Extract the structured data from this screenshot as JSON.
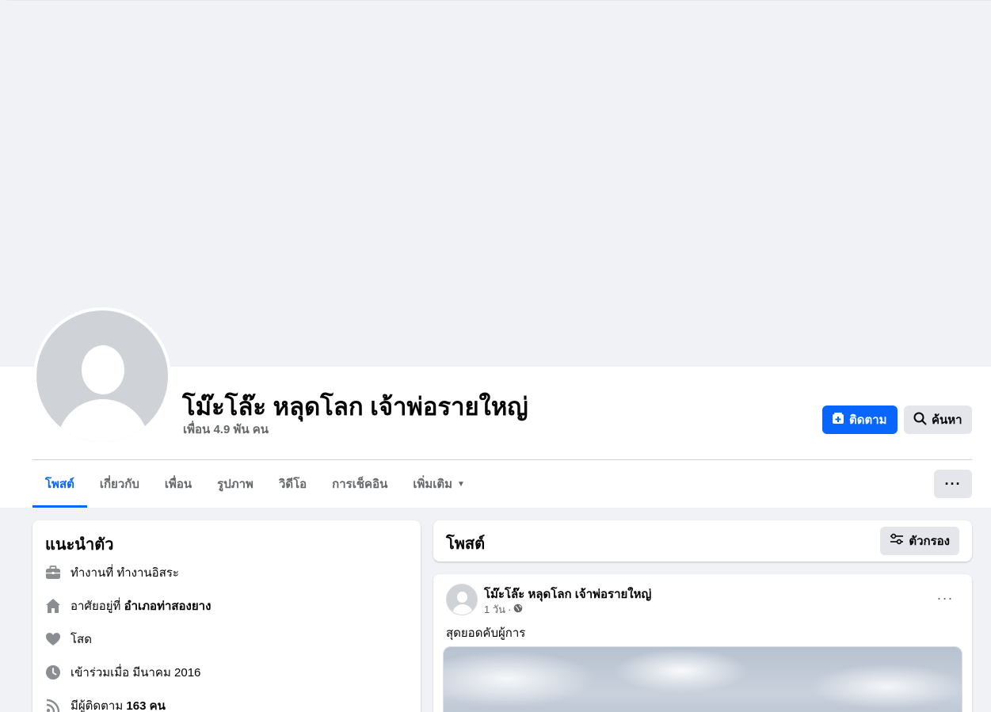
{
  "profile": {
    "name": "โม๊ะโล๊ะ หลุดโลก เจ้าพ่อรายใหญ่",
    "friends": "เพื่อน 4.9 พัน คน"
  },
  "actions": {
    "follow_label": "ติดตาม",
    "search_label": "ค้นหา",
    "more_label": "···"
  },
  "tabs": [
    {
      "label": "โพสต์",
      "active": true
    },
    {
      "label": "เกี่ยวกับ",
      "active": false
    },
    {
      "label": "เพื่อน",
      "active": false
    },
    {
      "label": "รูปภาพ",
      "active": false
    },
    {
      "label": "วิดีโอ",
      "active": false
    },
    {
      "label": "การเช็คอิน",
      "active": false
    },
    {
      "label": "เพิ่มเติม",
      "active": false
    }
  ],
  "intro": {
    "title": "แนะนำตัว",
    "work": {
      "prefix": "ทำงานที่",
      "value": "ทำงานอิสระ",
      "icon": "briefcase-icon"
    },
    "lives": {
      "prefix": "อาศัยอยู่ที่",
      "value": "อำเภอท่าสองยาง",
      "icon": "home-icon"
    },
    "relationship": {
      "value": "โสด",
      "icon": "heart-icon"
    },
    "joined": {
      "value": "เข้าร่วมเมื่อ มีนาคม 2016",
      "icon": "clock-icon"
    },
    "followers": {
      "prefix": "มีผู้ติดตาม",
      "value": "163 คน",
      "icon": "rss-icon"
    }
  },
  "posts_section": {
    "title": "โพสต์",
    "filter_label": "ตัวกรอง"
  },
  "post": {
    "author": "โม๊ะโล๊ะ หลุดโลก เจ้าพ่อรายใหญ่",
    "time": "1 วัน",
    "separator": "·",
    "privacy_icon": "globe-icon",
    "text": "สุดยอดคับผู้การ"
  },
  "colors": {
    "accent": "#0866ff",
    "background": "#f0f2f5",
    "secondary_text": "#65676b",
    "icon_gray": "#8a8d91"
  }
}
